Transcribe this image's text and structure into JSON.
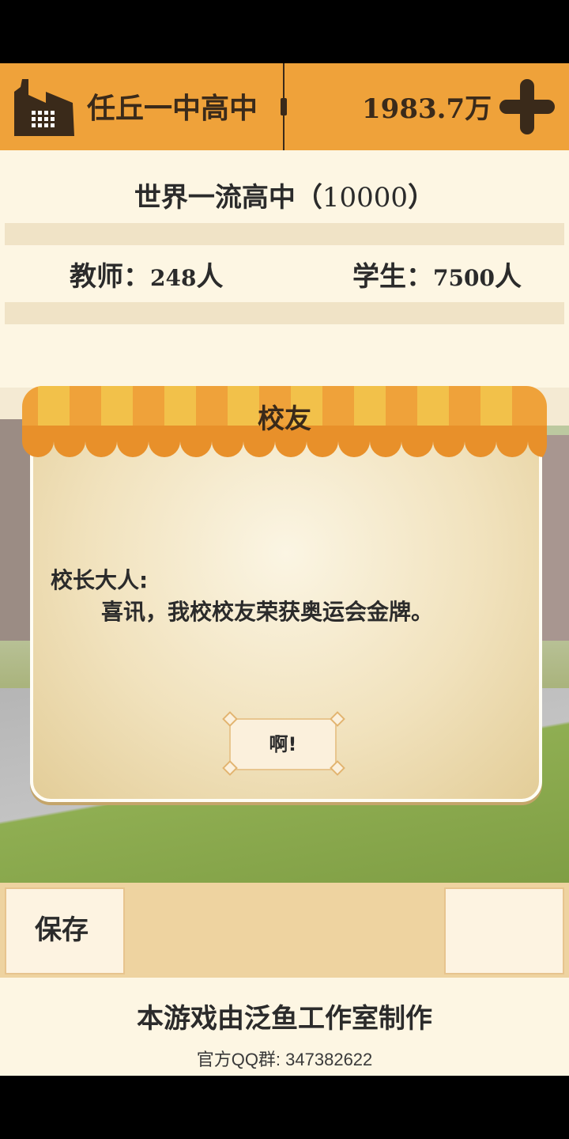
{
  "header": {
    "school_name": "任丘一中高中",
    "money": "1983.7万",
    "add_icon": "plus-icon",
    "school_icon": "factory-icon"
  },
  "info": {
    "level_label": "世界一流高中",
    "level_value": "10000",
    "teachers_label": "教师",
    "teachers_value": "248",
    "teachers_unit": "人",
    "students_label": "学生",
    "students_value": "7500",
    "students_unit": "人"
  },
  "dialog": {
    "title": "校友",
    "greeting": "校长大人:",
    "message": "喜讯，我校校友荣获奥运会金牌。",
    "ok_label": "啊!"
  },
  "bottom_bar": {
    "save_label": "保存",
    "right_label": ""
  },
  "footer": {
    "credits": "本游戏由泛鱼工作室制作",
    "qq_group": "官方QQ群:  347382622"
  },
  "colors": {
    "header_bg": "#efa23a",
    "panel_bg": "#fdf6e3",
    "awning_orange": "#efa23a",
    "awning_yellow": "#f2c14a"
  }
}
